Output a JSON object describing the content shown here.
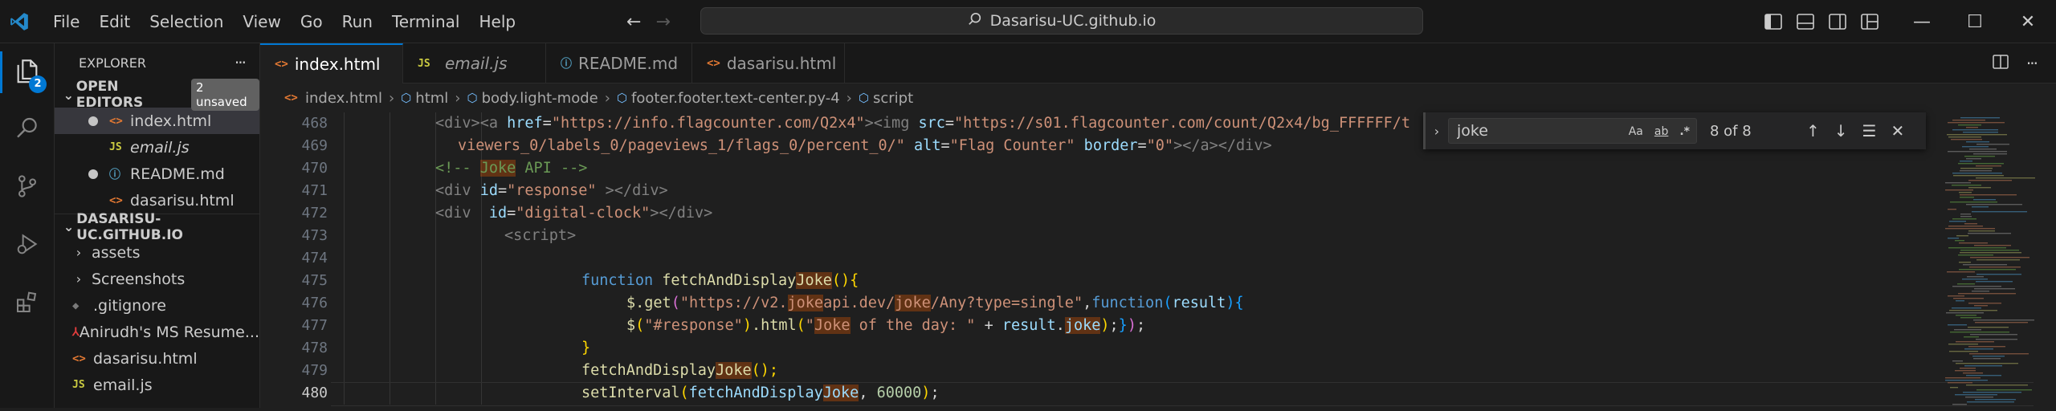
{
  "menu": [
    "File",
    "Edit",
    "Selection",
    "View",
    "Go",
    "Run",
    "Terminal",
    "Help"
  ],
  "command_center": {
    "label": "Dasarisu-UC.github.io"
  },
  "activity": {
    "explorer_badge": "2"
  },
  "explorer": {
    "title": "EXPLORER",
    "more": "···",
    "open_editors": {
      "label": "OPEN EDITORS",
      "badge": "2 unsaved",
      "items": [
        "index.html",
        "email.js",
        "README.md",
        "dasarisu.html"
      ]
    },
    "workspace": {
      "label": "DASARISU-UC.GITHUB.IO",
      "items": [
        "assets",
        "Screenshots",
        ".gitignore",
        "Anirudh's MS Resume...",
        "dasarisu.html",
        "email.js"
      ]
    }
  },
  "tabs": [
    "index.html",
    "email.js",
    "README.md",
    "dasarisu.html"
  ],
  "icons": {
    "html": "<>",
    "js": "JS",
    "info": "ⓘ",
    "git": "◆",
    "pdf": "⅄"
  },
  "breadcrumb": [
    "index.html",
    "html",
    "body.light-mode",
    "footer.footer.text-center.py-4",
    "script"
  ],
  "find": {
    "query": "joke",
    "opt_case": "Aa",
    "opt_word": "ab",
    "opt_regex": ".*",
    "count": "8 of 8"
  },
  "editor": {
    "line_numbers": [
      "468",
      "469",
      "470",
      "471",
      "472",
      "473",
      "474",
      "475",
      "476",
      "477",
      "478",
      "479",
      "480"
    ],
    "current_line": "480",
    "code": {
      "l468_a": "<div><a ",
      "l468_href": "href",
      "l468_hrefval": "\"https://info.flagcounter.com/Q2x4\"",
      "l468_img": "><img ",
      "l468_src": "src",
      "l468_srcval": "\"https://s01.flagcounter.com/count/Q2x4/bg_FFFFFF/t",
      "l469_str": "viewers_0/labels_0/pageviews_1/flags_0/percent_0/\"",
      "l469_alt": " alt",
      "l469_altval": "\"Flag Counter\"",
      "l469_border": " border",
      "l469_borderval": "\"0\"",
      "l469_end": "></a></div>",
      "l470_pre": "<!-- ",
      "l470_hl": "Joke",
      "l470_post": " API -->",
      "l471_open": "<div ",
      "l471_id": "id",
      "l471_val": "\"response\"",
      "l471_end": " ></div>",
      "l472_open": "<div  ",
      "l472_id": "id",
      "l472_val": "\"digital-clock\"",
      "l472_end": "></div>",
      "l473": "<script>",
      "l475_kw": "function ",
      "l475_fn1": "fetchAndDisplay",
      "l475_hl": "Joke",
      "l475_end": "(){",
      "l476_fn": "$.get",
      "l476_str1": "\"https://v2.",
      "l476_hl": "joke",
      "l476_str2": "api.dev/",
      "l476_hl2": "joke",
      "l476_str3": "/Any?type=single\"",
      "l476_kw": "function",
      "l476_param": "result",
      "l477_fn": "$",
      "l477_str": "\"#response\"",
      "l477_html": ".html",
      "l477_str2": "\"",
      "l477_hl": "Joke",
      "l477_str3": " of the day: \"",
      "l477_plus": " + ",
      "l477_var": "result",
      "l477_dot": ".",
      "l477_hl2": "joke",
      "l477_end": ");",
      "l478": "}",
      "l479_fn": "fetchAndDisplay",
      "l479_hl": "Joke",
      "l479_end": "();",
      "l480_fn": "setInterval",
      "l480_arg": "fetchAndDisplay",
      "l480_hl": "Joke",
      "l480_num": "60000",
      "l480_end": ");"
    }
  }
}
